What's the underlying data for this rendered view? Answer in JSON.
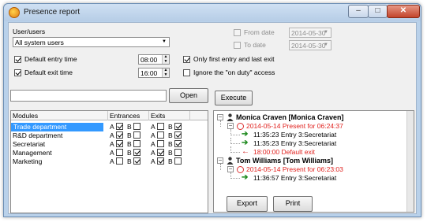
{
  "window": {
    "title": "Presence report"
  },
  "filters": {
    "users_label": "User/users",
    "users_value": "All system users",
    "default_entry_label": "Default entry time",
    "default_entry_value": "08:00",
    "default_exit_label": "Default exit time",
    "default_exit_value": "16:00",
    "from_date_label": "From date",
    "from_date_value": "2014-05-30",
    "to_date_label": "To date",
    "to_date_value": "2014-05-30",
    "only_first_last_label": "Only first entry and last exit",
    "ignore_on_duty_label": "Ignore the \"on duty\" access"
  },
  "actions": {
    "open_label": "Open",
    "execute_label": "Execute",
    "export_label": "Export",
    "print_label": "Print"
  },
  "modules_table": {
    "columns": [
      "Modules",
      "Entrances",
      "Exits"
    ],
    "letters": {
      "a": "A",
      "b": "B"
    },
    "rows": [
      {
        "name": "Trade department",
        "entrA": true,
        "entrB": false,
        "exitA": false,
        "exitB": true
      },
      {
        "name": "R&D department",
        "entrA": true,
        "entrB": false,
        "exitA": false,
        "exitB": true
      },
      {
        "name": "Secretariat",
        "entrA": true,
        "entrB": false,
        "exitA": false,
        "exitB": true
      },
      {
        "name": "Management",
        "entrA": false,
        "entrB": true,
        "exitA": true,
        "exitB": false
      },
      {
        "name": "Marketing",
        "entrA": false,
        "entrB": true,
        "exitA": true,
        "exitB": false
      }
    ]
  },
  "report_tree": {
    "people": [
      {
        "name": "Monica Craven [Monica Craven]",
        "day": "2014-05-14  Present for 06:24:37",
        "events": [
          {
            "text": "11:35:23  Entry 3:Secretariat",
            "kind": "in"
          },
          {
            "text": "11:35:23  Entry 3:Secretariat",
            "kind": "in"
          },
          {
            "text": "18:00:00  Default exit",
            "kind": "out"
          }
        ]
      },
      {
        "name": "Tom Williams [Tom Williams]",
        "day": "2014-05-14  Present for 06:23:03",
        "events": [
          {
            "text": "11:36:57  Entry 3:Secretariat",
            "kind": "in"
          }
        ]
      }
    ]
  },
  "colors": {
    "selection": "#3399ff",
    "entry_arrow": "#1f8a1f",
    "exit_arrow": "#cc1111",
    "day_text": "#e0201d",
    "window_frame": "#b9d1ea"
  },
  "icons": [
    "app-icon",
    "minimize-icon",
    "maximize-icon",
    "close-icon",
    "person-icon",
    "clock-icon",
    "entry-arrow-icon",
    "exit-arrow-icon"
  ]
}
